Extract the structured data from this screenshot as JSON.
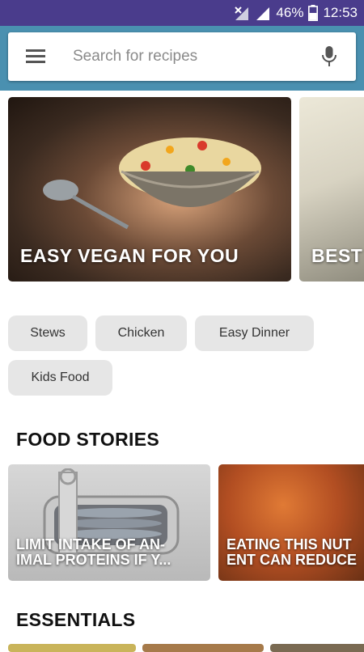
{
  "status_bar": {
    "battery": "46%",
    "time": "12:53"
  },
  "search": {
    "placeholder": "Search for recipes"
  },
  "hero_cards": [
    {
      "title": "EASY VEGAN FOR YOU"
    },
    {
      "title": "BEST"
    }
  ],
  "chips": [
    "Stews",
    "Chicken",
    "Easy Dinner",
    "Kids Food"
  ],
  "sections": {
    "food_stories": "FOOD STORIES",
    "essentials": "ESSENTIALS"
  },
  "stories": [
    {
      "title": "LIMIT INTAKE OF AN-\nIMAL PROTEINS IF Y..."
    },
    {
      "title": "EATING THIS NUT\nENT CAN REDUCE"
    }
  ],
  "colors": {
    "status_bar": "#4a3c8c",
    "header": "#4a90b0",
    "chip_bg": "#e6e6e6"
  }
}
